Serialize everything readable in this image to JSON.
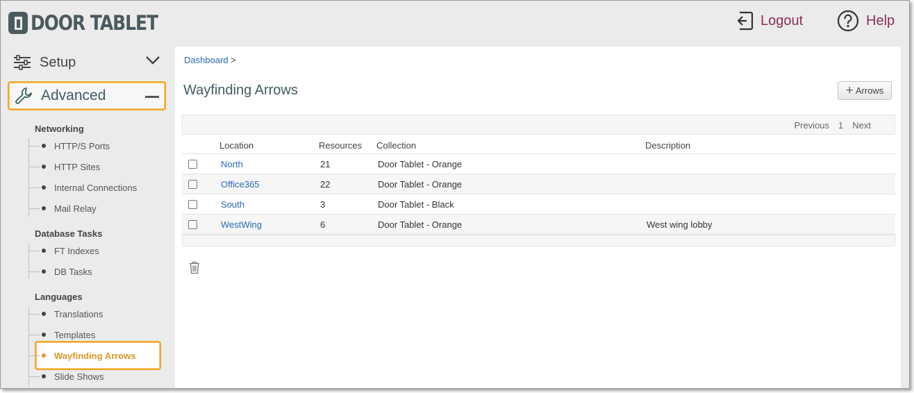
{
  "header": {
    "logo_text": "DOOR TABLET",
    "logout_label": "Logout",
    "help_label": "Help"
  },
  "sidebar": {
    "setup_label": "Setup",
    "advanced_label": "Advanced",
    "groups": [
      {
        "title": "Networking",
        "items": [
          "HTTP/S Ports",
          "HTTP Sites",
          "Internal Connections",
          "Mail Relay"
        ]
      },
      {
        "title": "Database Tasks",
        "items": [
          "FT Indexes",
          "DB Tasks"
        ]
      },
      {
        "title": "Languages",
        "items": [
          "Translations",
          "Templates",
          "Wayfinding Arrows",
          "Slide Shows"
        ]
      }
    ],
    "active_item": "Wayfinding Arrows"
  },
  "main": {
    "breadcrumb_link": "Dashboard",
    "breadcrumb_sep": ">",
    "title": "Wayfinding Arrows",
    "add_button_label": "Arrows",
    "pager": {
      "previous": "Previous",
      "page": "1",
      "next": "Next"
    },
    "columns": [
      "Location",
      "Resources",
      "Collection",
      "Description"
    ],
    "rows": [
      {
        "location": "North",
        "resources": "21",
        "collection": "Door Tablet - Orange",
        "description": ""
      },
      {
        "location": "Office365",
        "resources": "22",
        "collection": "Door Tablet - Orange",
        "description": ""
      },
      {
        "location": "South",
        "resources": "3",
        "collection": "Door Tablet - Black",
        "description": ""
      },
      {
        "location": "WestWing",
        "resources": "6",
        "collection": "Door Tablet - Orange",
        "description": "West wing lobby"
      }
    ]
  },
  "colors": {
    "header_link": "#8b2f5a",
    "highlight": "#f2a62b",
    "active_item": "#e0962a",
    "link": "#2a6ab4",
    "title": "#3f5c63"
  },
  "icons": {
    "setup": "sliders-icon",
    "advanced": "wrench-icon",
    "logout": "logout-icon",
    "help": "question-circle-icon",
    "delete": "trash-icon"
  }
}
